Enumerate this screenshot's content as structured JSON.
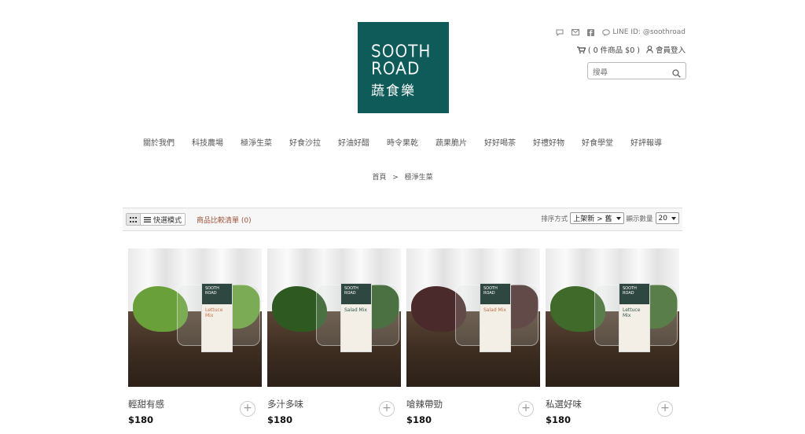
{
  "logo": {
    "line1": "SOOTH",
    "line2": "ROAD",
    "line3": "蔬食樂"
  },
  "header": {
    "line_id": "LINE ID: @soothroad",
    "cart": "( 0 件商品 $0 )",
    "login": "會員登入",
    "search_placeholder": "搜尋"
  },
  "nav": [
    "關於我們",
    "科技農場",
    "極淨生菜",
    "好食沙拉",
    "好油好醋",
    "時令果乾",
    "蔬果脆片",
    "好好喝茶",
    "好禮好物",
    "好食學堂",
    "好評報導"
  ],
  "breadcrumb": {
    "home": "首頁",
    "sep": ">",
    "current": "極淨生菜"
  },
  "toolbar": {
    "quick_view": "快選模式",
    "compare": "商品比較清單 (0)",
    "sort_label": "排序方式",
    "sort_value": "上架新 > 舊",
    "count_label": "顯示數量",
    "count_value": "20"
  },
  "products": [
    {
      "name": "輕甜有感",
      "price": "$180",
      "pack": "Lettuce Mix",
      "pack_color": "#c0704a",
      "greens": "#6aa03a"
    },
    {
      "name": "多汁多味",
      "price": "$180",
      "pack": "Salad Mix",
      "pack_color": "#2f5a4a",
      "greens": "#2e5a22"
    },
    {
      "name": "嗆辣帶勁",
      "price": "$180",
      "pack": "Salad Mix",
      "pack_color": "#c0704a",
      "greens": "#4a2a2a"
    },
    {
      "name": "私選好味",
      "price": "$180",
      "pack": "Lettuce Mix",
      "pack_color": "#2f5a4a",
      "greens": "#3f6a2a"
    }
  ],
  "colors": {
    "brand": "#0f5b5a",
    "compare_link": "#a0533a"
  }
}
